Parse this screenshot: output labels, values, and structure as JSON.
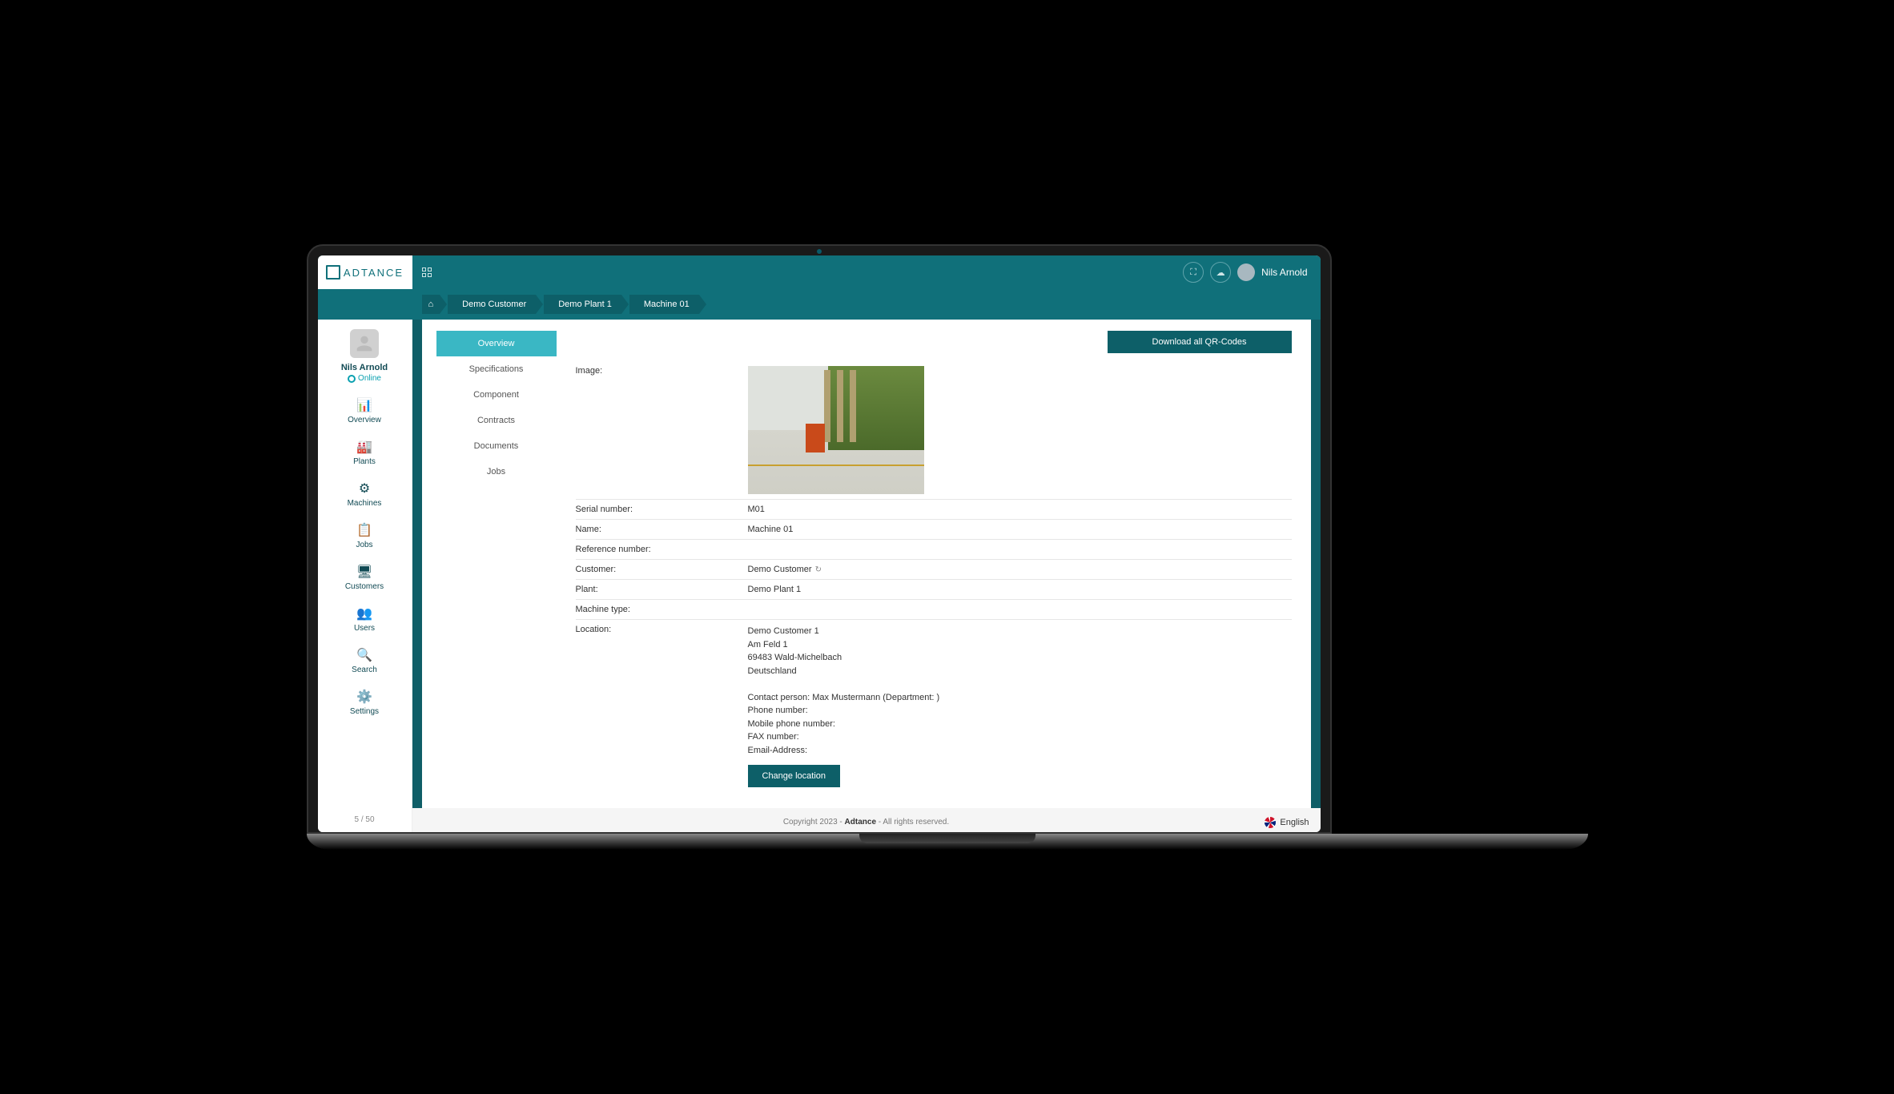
{
  "brand": "ADTANCE",
  "topbar": {
    "username": "Nils Arnold"
  },
  "breadcrumbs": [
    "Demo Customer",
    "Demo Plant 1",
    "Machine 01"
  ],
  "sidebar": {
    "name": "Nils Arnold",
    "status": "Online",
    "items": [
      {
        "icon": "📊",
        "label": "Overview"
      },
      {
        "icon": "🏭",
        "label": "Plants"
      },
      {
        "icon": "⚙",
        "label": "Machines"
      },
      {
        "icon": "📋",
        "label": "Jobs"
      },
      {
        "icon": "🖥",
        "label": "Customers"
      },
      {
        "icon": "👥",
        "label": "Users"
      },
      {
        "icon": "🔍",
        "label": "Search"
      },
      {
        "icon": "⚙️",
        "label": "Settings"
      }
    ],
    "footer": "5 / 50"
  },
  "subtabs": [
    "Overview",
    "Specifications",
    "Component",
    "Contracts",
    "Documents",
    "Jobs"
  ],
  "buttons": {
    "download_qr": "Download all QR-Codes",
    "change_location": "Change location"
  },
  "fields": {
    "image_label": "Image:",
    "serial_label": "Serial number:",
    "serial_value": "M01",
    "name_label": "Name:",
    "name_value": "Machine 01",
    "ref_label": "Reference number:",
    "ref_value": "",
    "customer_label": "Customer:",
    "customer_value": "Demo Customer",
    "plant_label": "Plant:",
    "plant_value": "Demo Plant 1",
    "type_label": "Machine type:",
    "type_value": "",
    "location_label": "Location:",
    "location": {
      "line1": "Demo Customer 1",
      "line2": "Am Feld 1",
      "line3": "69483 Wald-Michelbach",
      "line4": "Deutschland",
      "contact": "Contact person: Max Mustermann (Department: )",
      "phone": "Phone number:",
      "mobile": "Mobile phone number:",
      "fax": "FAX number:",
      "email": "Email-Address:"
    }
  },
  "footer": {
    "copyright": "Copyright 2023 -",
    "brand": "Adtance",
    "rights": "- All rights reserved.",
    "lang": "English"
  }
}
